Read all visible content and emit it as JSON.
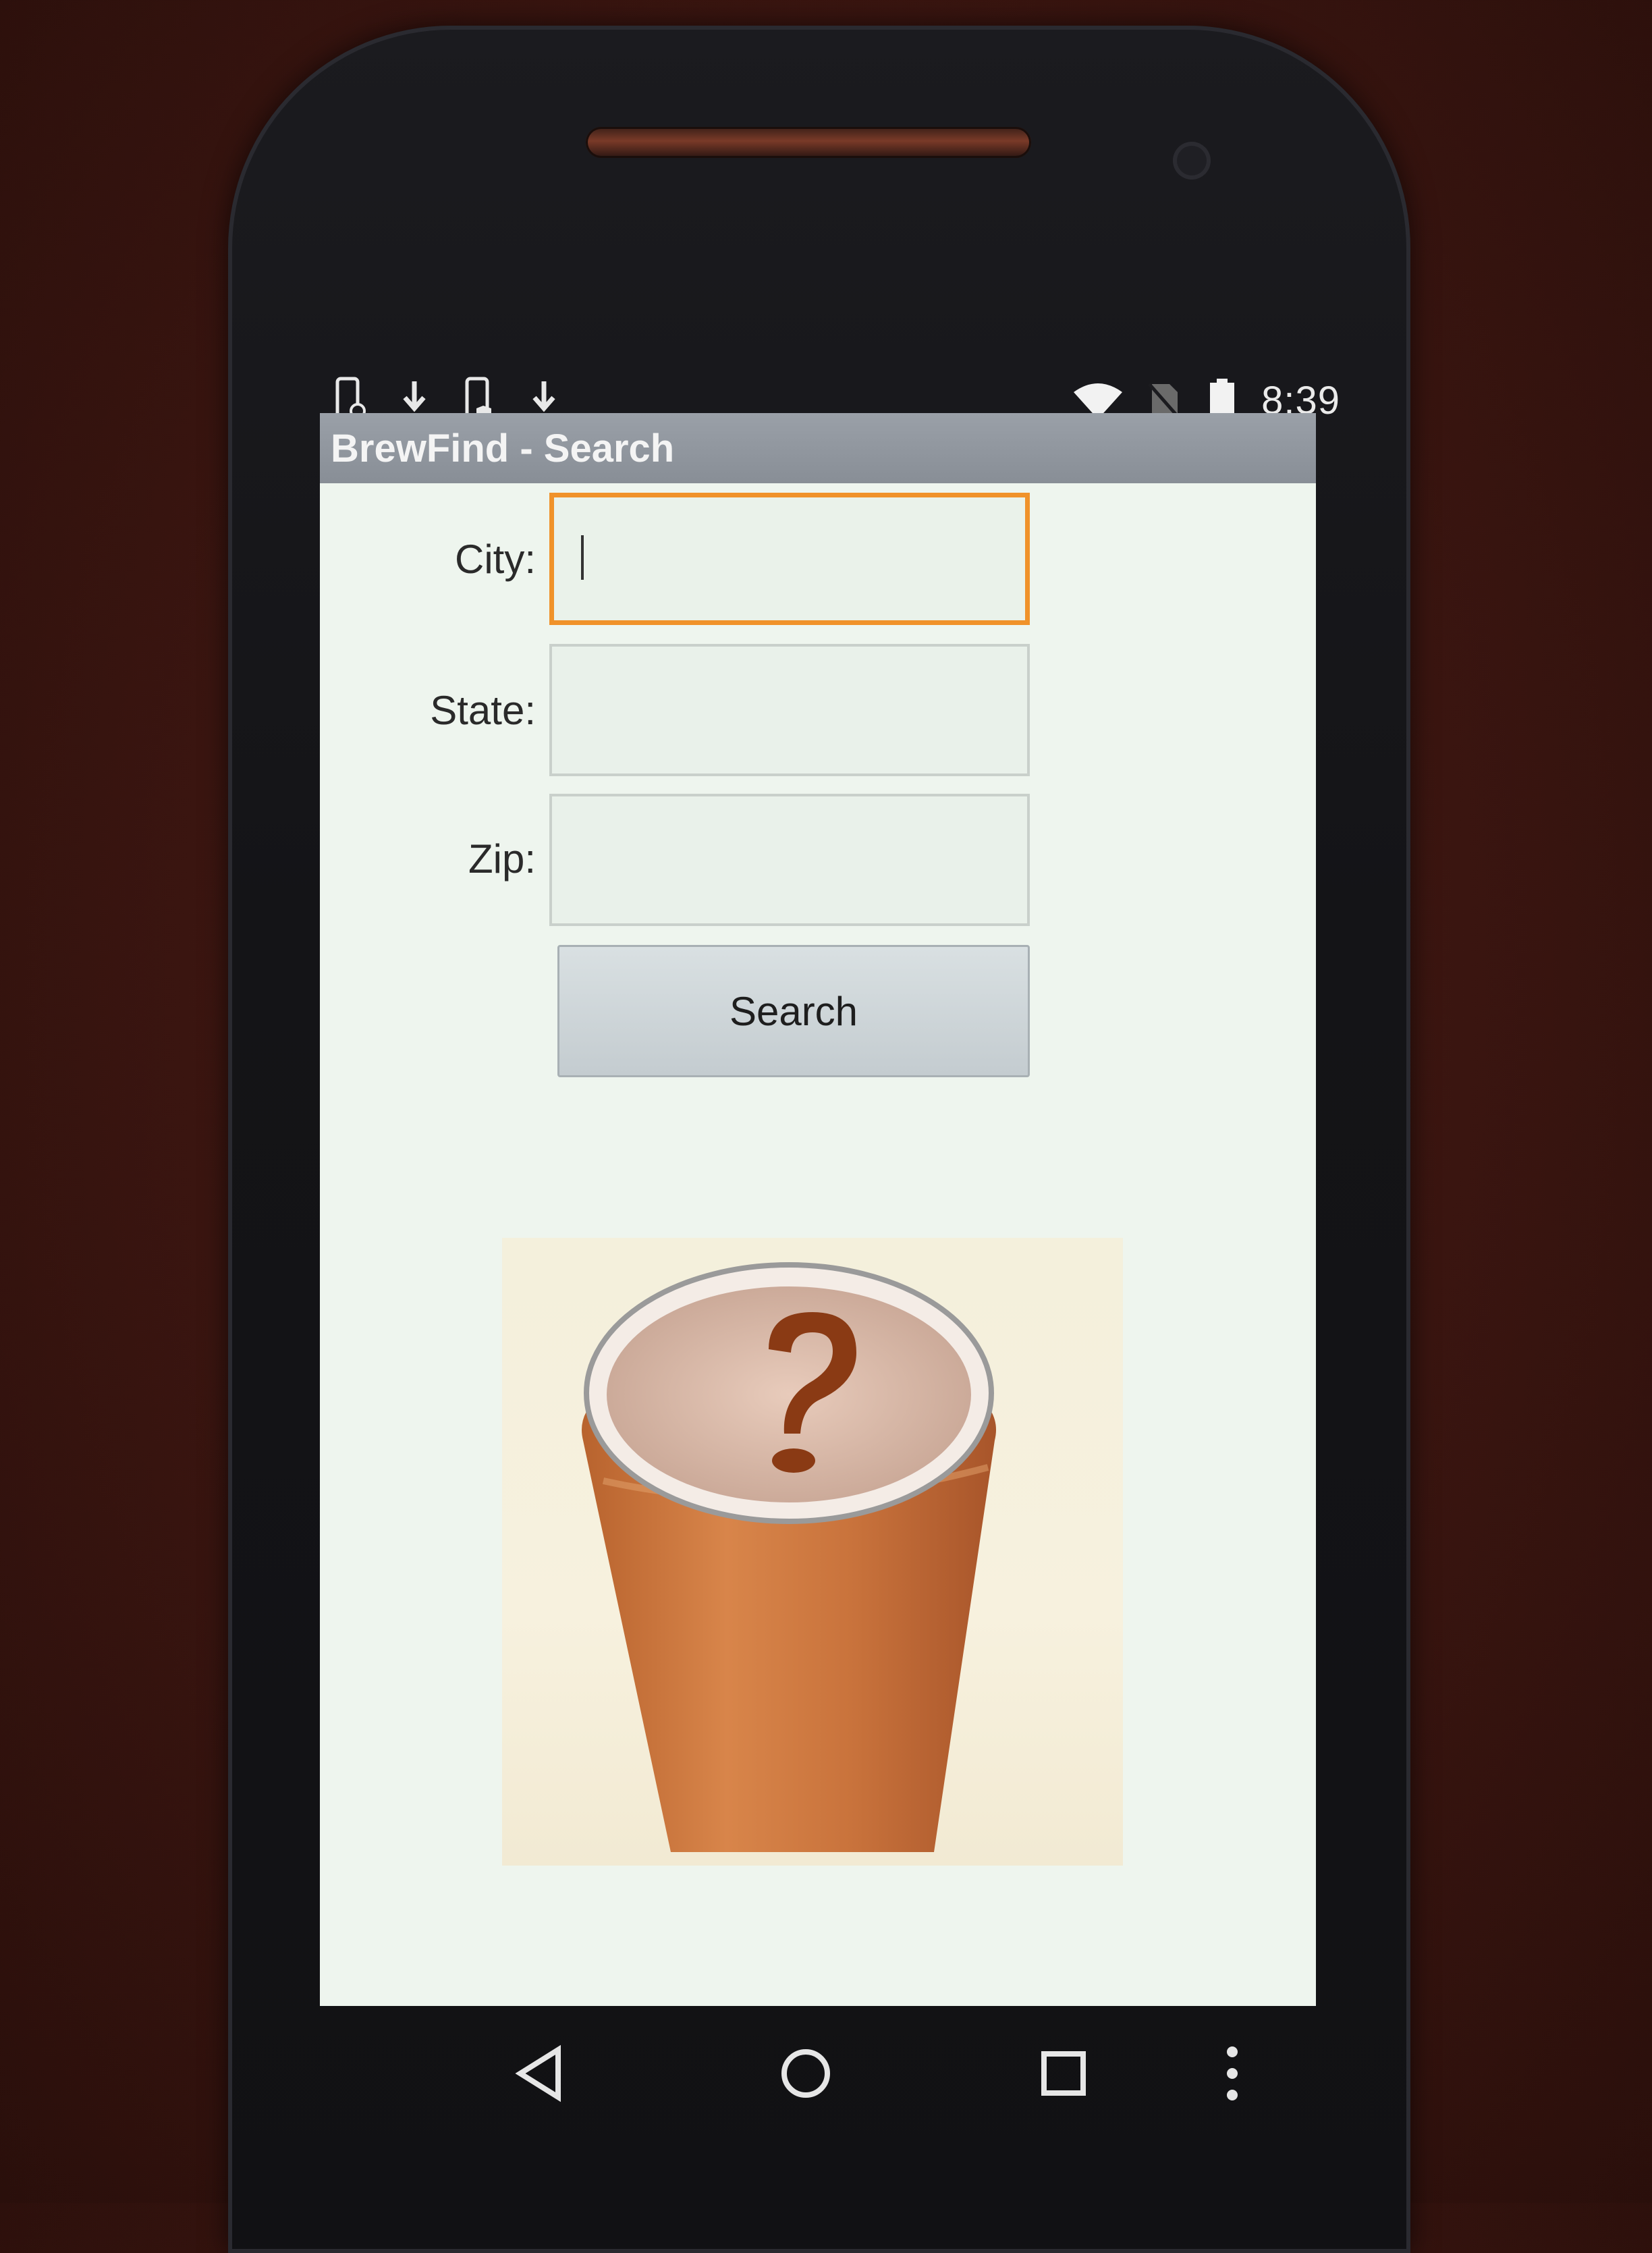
{
  "status_bar": {
    "time": "8:39",
    "left_icons": [
      "phone-sync-icon",
      "download-icon",
      "phone-shield-icon",
      "download-icon"
    ],
    "right_icons": [
      "wifi-icon",
      "no-sim-icon",
      "battery-icon"
    ]
  },
  "app": {
    "title": "BrewFind - Search"
  },
  "form": {
    "city_label": "City:",
    "city_value": "",
    "state_label": "State:",
    "state_value": "",
    "zip_label": "Zip:",
    "zip_value": "",
    "search_label": "Search",
    "focus_color": "#f0922a"
  },
  "image": {
    "icon": "beer-question-mark-image"
  },
  "nav_bar": {
    "buttons": [
      "back-icon",
      "home-icon",
      "recents-icon",
      "menu-icon"
    ]
  }
}
